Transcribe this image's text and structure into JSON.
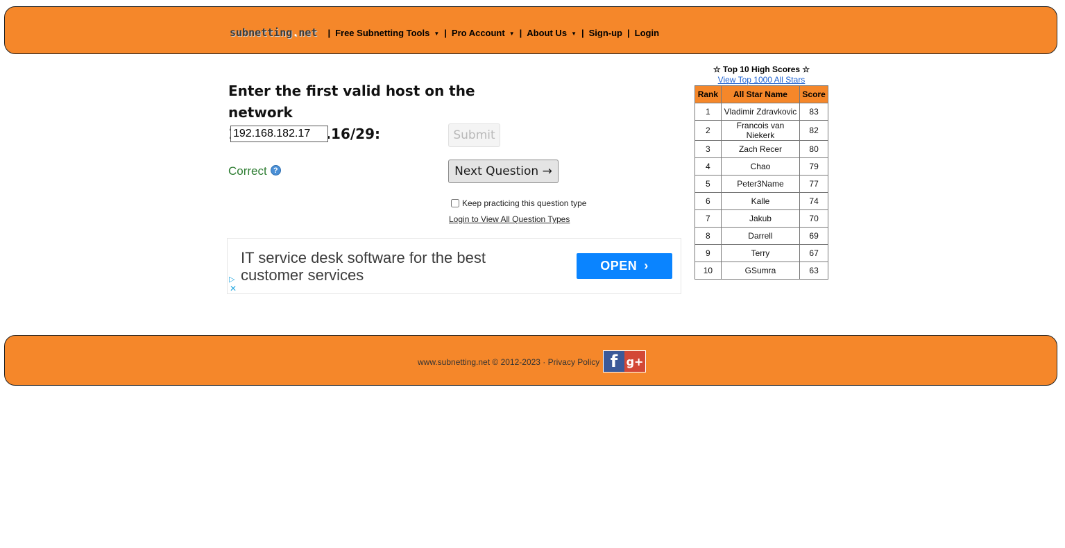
{
  "nav": {
    "logo": "subnetting.net",
    "logo_main": "subnetting",
    "logo_dot": ".",
    "logo_tld": "net",
    "separator": "|",
    "items": [
      {
        "label": "Free Subnetting Tools",
        "dropdown": true
      },
      {
        "label": "Pro Account",
        "dropdown": true
      },
      {
        "label": "About Us",
        "dropdown": true
      },
      {
        "label": "Sign-up",
        "dropdown": false
      },
      {
        "label": "Login",
        "dropdown": false
      }
    ],
    "caret_icon": "caret-down-icon"
  },
  "quiz": {
    "question_line1": "Enter the first valid host on the network",
    "question_line2": "192.168.182.16/29:",
    "answer_value": "192.168.182.17",
    "submit_label": "Submit",
    "result": "Correct",
    "help_icon": "?",
    "next_label": "Next Question →",
    "keep_practicing_label": "Keep practicing this question type",
    "keep_practicing_checked": false,
    "login_link": "Login to View All Question Types"
  },
  "ad": {
    "text": "IT service desk software for the best customer services",
    "button": "OPEN",
    "button_icon": "›",
    "play_icon": "▷",
    "close_icon": "✕",
    "button_color": "#0a84ff"
  },
  "high_scores": {
    "title": "☆ Top 10 High Scores ☆",
    "link": "View Top 1000 All Stars",
    "columns": [
      "Rank",
      "All Star Name",
      "Score"
    ],
    "rows": [
      {
        "rank": "1",
        "name": "Vladimir Zdravkovic",
        "score": "83"
      },
      {
        "rank": "2",
        "name": "Francois van Niekerk",
        "score": "82"
      },
      {
        "rank": "3",
        "name": "Zach Recer",
        "score": "80"
      },
      {
        "rank": "4",
        "name": "Chao",
        "score": "79"
      },
      {
        "rank": "5",
        "name": "Peter3Name",
        "score": "77"
      },
      {
        "rank": "6",
        "name": "Kalle",
        "score": "74"
      },
      {
        "rank": "7",
        "name": "Jakub",
        "score": "70"
      },
      {
        "rank": "8",
        "name": "Darrell",
        "score": "69"
      },
      {
        "rank": "9",
        "name": "Terry",
        "score": "67"
      },
      {
        "rank": "10",
        "name": "GSumra",
        "score": "63"
      }
    ]
  },
  "footer": {
    "copyright": "www.subnetting.net © 2012-2023 · ",
    "privacy": "Privacy Policy",
    "facebook_icon": "f",
    "googleplus_icon": "g+"
  },
  "colors": {
    "brand_orange": "#f5872a",
    "correct_green": "#2e7d32"
  }
}
